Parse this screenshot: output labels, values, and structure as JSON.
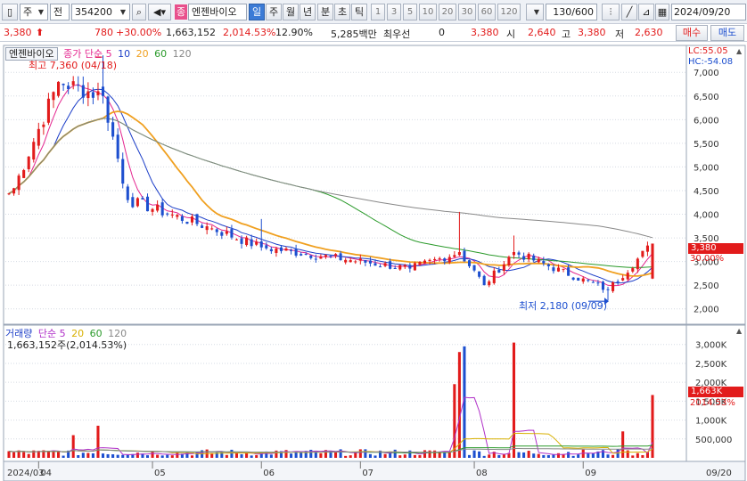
{
  "toolbar": {
    "market_select": "주",
    "market_dropdown": "전",
    "code_value": "354200",
    "name_badge": "종",
    "stock_name": "엔젠바이오",
    "periods": [
      "일",
      "주",
      "월",
      "년",
      "분",
      "초",
      "틱"
    ],
    "active_period": "일",
    "intervals": [
      "1",
      "3",
      "5",
      "10",
      "20",
      "30",
      "60",
      "120"
    ],
    "count_value": "130/600",
    "date_value": "2024/09/20"
  },
  "quote": {
    "price": "3,380",
    "change": "780",
    "change_pct": "+30.00%",
    "volume": "1,663,152",
    "volume_ratio": "2,014.53%",
    "turnover": "12.90%",
    "trade_value": "5,285백만",
    "top_label": "최우선",
    "top_value": "0",
    "price2": "3,380",
    "open_label": "시",
    "open_value": "2,640",
    "high_label": "고",
    "high_value": "3,380",
    "low_label": "저",
    "low_value": "2,630",
    "buy_button": "매수",
    "sell_button": "매도"
  },
  "price_panel": {
    "name_label": "엔젠바이오",
    "ma_prefix": "종가 단순",
    "ma_periods": [
      "5",
      "10",
      "20",
      "60",
      "120"
    ],
    "ma_colors": [
      "#e4268f",
      "#1d3fc8",
      "#f0a020",
      "#2a9a2a",
      "#888888"
    ],
    "high_annotation": "최고 7,360 (04/18)",
    "low_annotation": "최저 2,180 (09/09)",
    "lc_label": "LC:55.05",
    "hc_label": "HC:-54.08",
    "current_price_tag": "3,380",
    "current_pct_tag": "30.00%"
  },
  "volume_panel": {
    "title": "거래량",
    "ma_prefix": "단순",
    "ma_periods": [
      "5",
      "20",
      "60",
      "120"
    ],
    "ma_colors": [
      "#b030c8",
      "#d8b000",
      "#2a9a2a",
      "#888888"
    ],
    "summary": "1,663,152주(2,014.53%)",
    "current_tag": "1,663K",
    "current_pct_tag": "2014.53%"
  },
  "x_axis": {
    "labels": [
      "2024/03",
      "04",
      "05",
      "06",
      "07",
      "08",
      "09"
    ],
    "right_label": "09/20"
  },
  "colors": {
    "up": "#e21b1b",
    "down": "#1d4fcf",
    "accent": "#3c7bd6",
    "tag_bg": "#e21b1b"
  },
  "chart_data": [
    {
      "type": "candlestick",
      "title": "엔젠바이오",
      "ylim": [
        1750,
        7400
      ],
      "y_ticks": [
        2000,
        2500,
        3000,
        3500,
        4000,
        4500,
        5000,
        5500,
        6000,
        6500,
        7000
      ],
      "y_tick_labels": [
        "2,000",
        "2,500",
        "3,000",
        "3,500",
        "4,000",
        "4,500",
        "5,000",
        "5,500",
        "6,000",
        "6,500",
        "7,000"
      ],
      "ohlc_anchors": [
        {
          "date": "2024/03/25",
          "close": 4550
        },
        {
          "date": "2024/04/05",
          "close": 6800
        },
        {
          "date": "2024/04/18",
          "high": 7360,
          "close": 6500
        },
        {
          "date": "2024/04/25",
          "close": 4300
        },
        {
          "date": "2024/05/20",
          "close": 3700
        },
        {
          "date": "2024/06/03",
          "high": 3900,
          "close": 3300
        },
        {
          "date": "2024/07/15",
          "close": 2850
        },
        {
          "date": "2024/07/29",
          "high": 4050,
          "close": 3200
        },
        {
          "date": "2024/08/05",
          "close": 2500
        },
        {
          "date": "2024/08/13",
          "high": 3550,
          "close": 3200
        },
        {
          "date": "2024/09/09",
          "low": 2180,
          "close": 2400
        },
        {
          "date": "2024/09/20",
          "open": 2640,
          "high": 3380,
          "low": 2630,
          "close": 3380
        }
      ]
    },
    {
      "type": "bar",
      "title": "거래량",
      "ylim": [
        0,
        3300000
      ],
      "y_ticks": [
        500000,
        1000000,
        1500000,
        2000000,
        2500000,
        3000000
      ],
      "y_tick_labels": [
        "500,000",
        "1,000K",
        "1,500K",
        "2,000K",
        "2,500K",
        "3,000K"
      ],
      "notable_values": [
        {
          "date": "2024/04/10",
          "value": 600000
        },
        {
          "date": "2024/04/17",
          "value": 850000
        },
        {
          "date": "2024/07/26",
          "value": 1950000
        },
        {
          "date": "2024/07/29",
          "value": 2800000
        },
        {
          "date": "2024/07/30",
          "value": 2950000
        },
        {
          "date": "2024/08/13",
          "value": 3050000
        },
        {
          "date": "2024/09/12",
          "value": 700000
        },
        {
          "date": "2024/09/20",
          "value": 1663152
        }
      ]
    }
  ]
}
